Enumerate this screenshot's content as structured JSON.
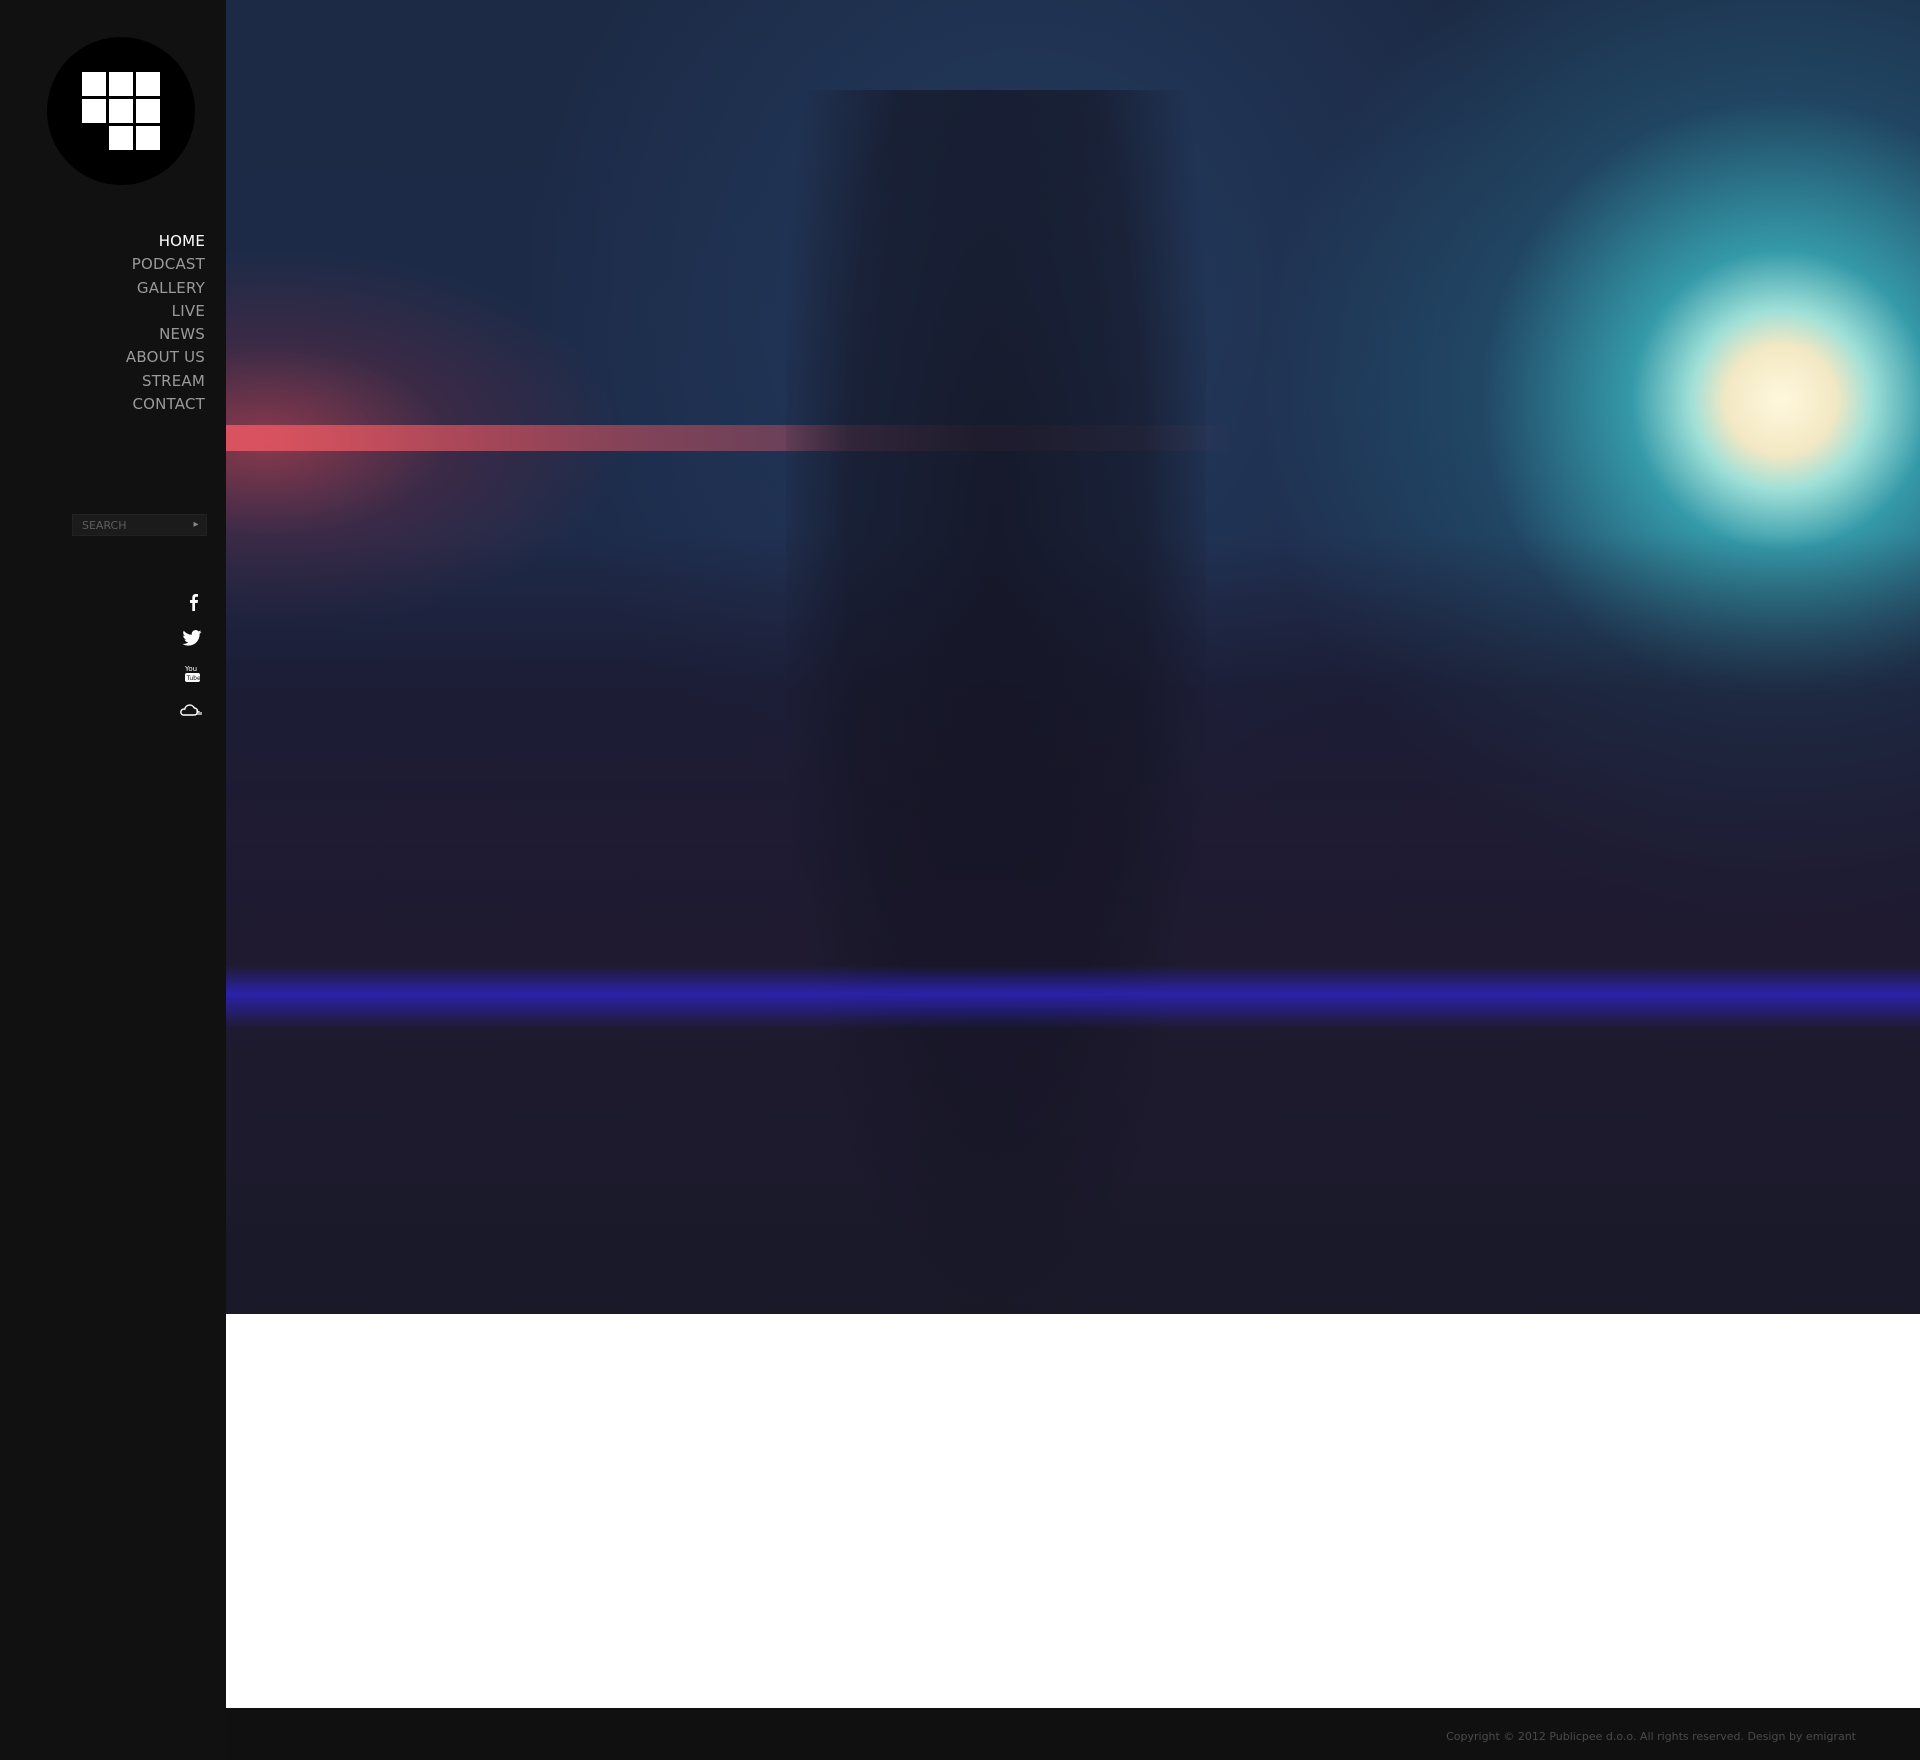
{
  "nav": {
    "items": [
      {
        "label": "HOME",
        "active": true
      },
      {
        "label": "PODCAST",
        "active": false
      },
      {
        "label": "GALLERY",
        "active": false
      },
      {
        "label": "LIVE",
        "active": false
      },
      {
        "label": "NEWS",
        "active": false
      },
      {
        "label": "ABOUT US",
        "active": false
      },
      {
        "label": "STREAM",
        "active": false
      },
      {
        "label": "CONTACT",
        "active": false
      }
    ]
  },
  "search": {
    "placeholder": "SEARCH",
    "submit_icon": "arrow-right-icon"
  },
  "social": {
    "icons": [
      "facebook-icon",
      "twitter-icon",
      "youtube-icon",
      "soundcloud-icon"
    ]
  },
  "hero": {
    "image": "party-crowd-photo"
  },
  "footer": {
    "copyright": "Copyright © 2012 Publicpee d.o.o. All rights reserved. Design by emigrant"
  },
  "colors": {
    "sidebar": "#111111",
    "accent_light": "#f2e8c4",
    "content": "#ffffff"
  }
}
